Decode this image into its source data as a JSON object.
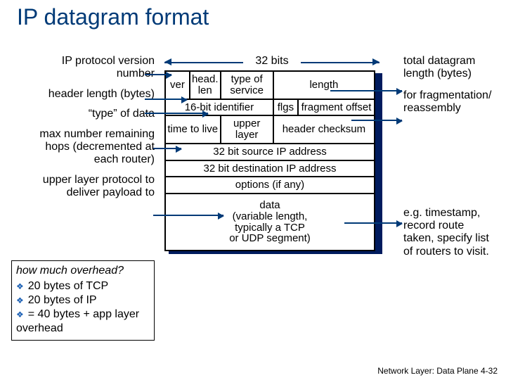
{
  "title": "IP datagram format",
  "width_label": "32 bits",
  "left": {
    "ver": "IP protocol version number",
    "hlen": "header length (bytes)",
    "type": "“type” of data",
    "ttl": "max number remaining hops (decremented at each router)",
    "proto": "upper layer protocol to deliver payload to"
  },
  "right": {
    "length": "total datagram length (bytes)",
    "frag": "for fragmentation/ reassembly",
    "options": "e.g. timestamp, record route taken, specify list of routers to visit."
  },
  "cells": {
    "ver": "ver",
    "hlen": "head. len",
    "tos": "type of service",
    "length": "length",
    "id": "16-bit identifier",
    "flgs": "flgs",
    "fragoff": "fragment offset",
    "ttl": "time to live",
    "proto": "upper layer",
    "cksum": "header checksum",
    "src": "32 bit source IP address",
    "dst": "32 bit destination IP address",
    "opts": "options (if any)",
    "data": "data\n(variable length,\ntypically a TCP\nor UDP segment)"
  },
  "overhead": {
    "question": "how much overhead?",
    "items": [
      "20 bytes of TCP",
      "20 bytes of IP",
      "= 40 bytes + app layer overhead"
    ]
  },
  "footer": "Network Layer: Data Plane   4-32"
}
